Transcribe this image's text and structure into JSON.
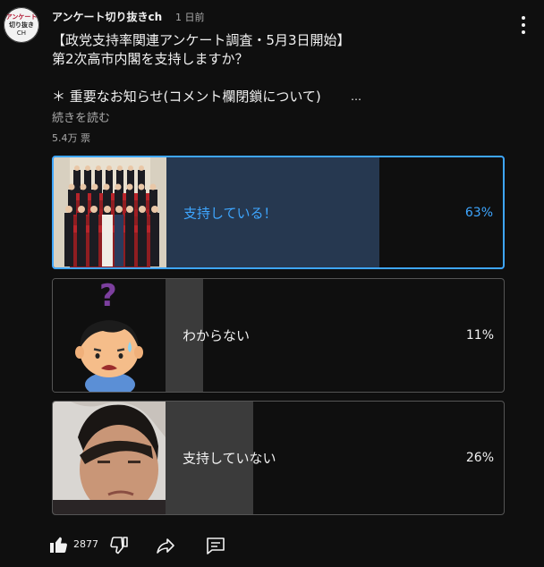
{
  "channel": {
    "avatar_line1": "アンケート",
    "avatar_line2": "切り抜き",
    "avatar_line3": "CH",
    "name": "アンケート切り抜きch",
    "time": "1 日前"
  },
  "post": {
    "line1": "【政党支持率関連アンケート調査・5月3日開始】",
    "line2": "第2次高市内閣を支持しますか？",
    "line3": "＊ 重要なお知らせ(コメント欄閉鎖について)",
    "ellipsis": "…",
    "read_more": "続きを読む",
    "votes": "5.4万 票"
  },
  "poll": {
    "accent_color": "#3ea6ff",
    "options": [
      {
        "label": "支持している！",
        "percent": "63%",
        "fraction": 0.63,
        "selected": true
      },
      {
        "label": "わからない",
        "percent": "11%",
        "fraction": 0.11,
        "selected": false
      },
      {
        "label": "支持していない",
        "percent": "26%",
        "fraction": 0.26,
        "selected": false
      }
    ]
  },
  "actions": {
    "like_count": "2877",
    "like_icon": "thumbs-up-icon",
    "dislike_icon": "thumbs-down-icon",
    "share_icon": "share-icon",
    "comment_icon": "comment-icon"
  }
}
